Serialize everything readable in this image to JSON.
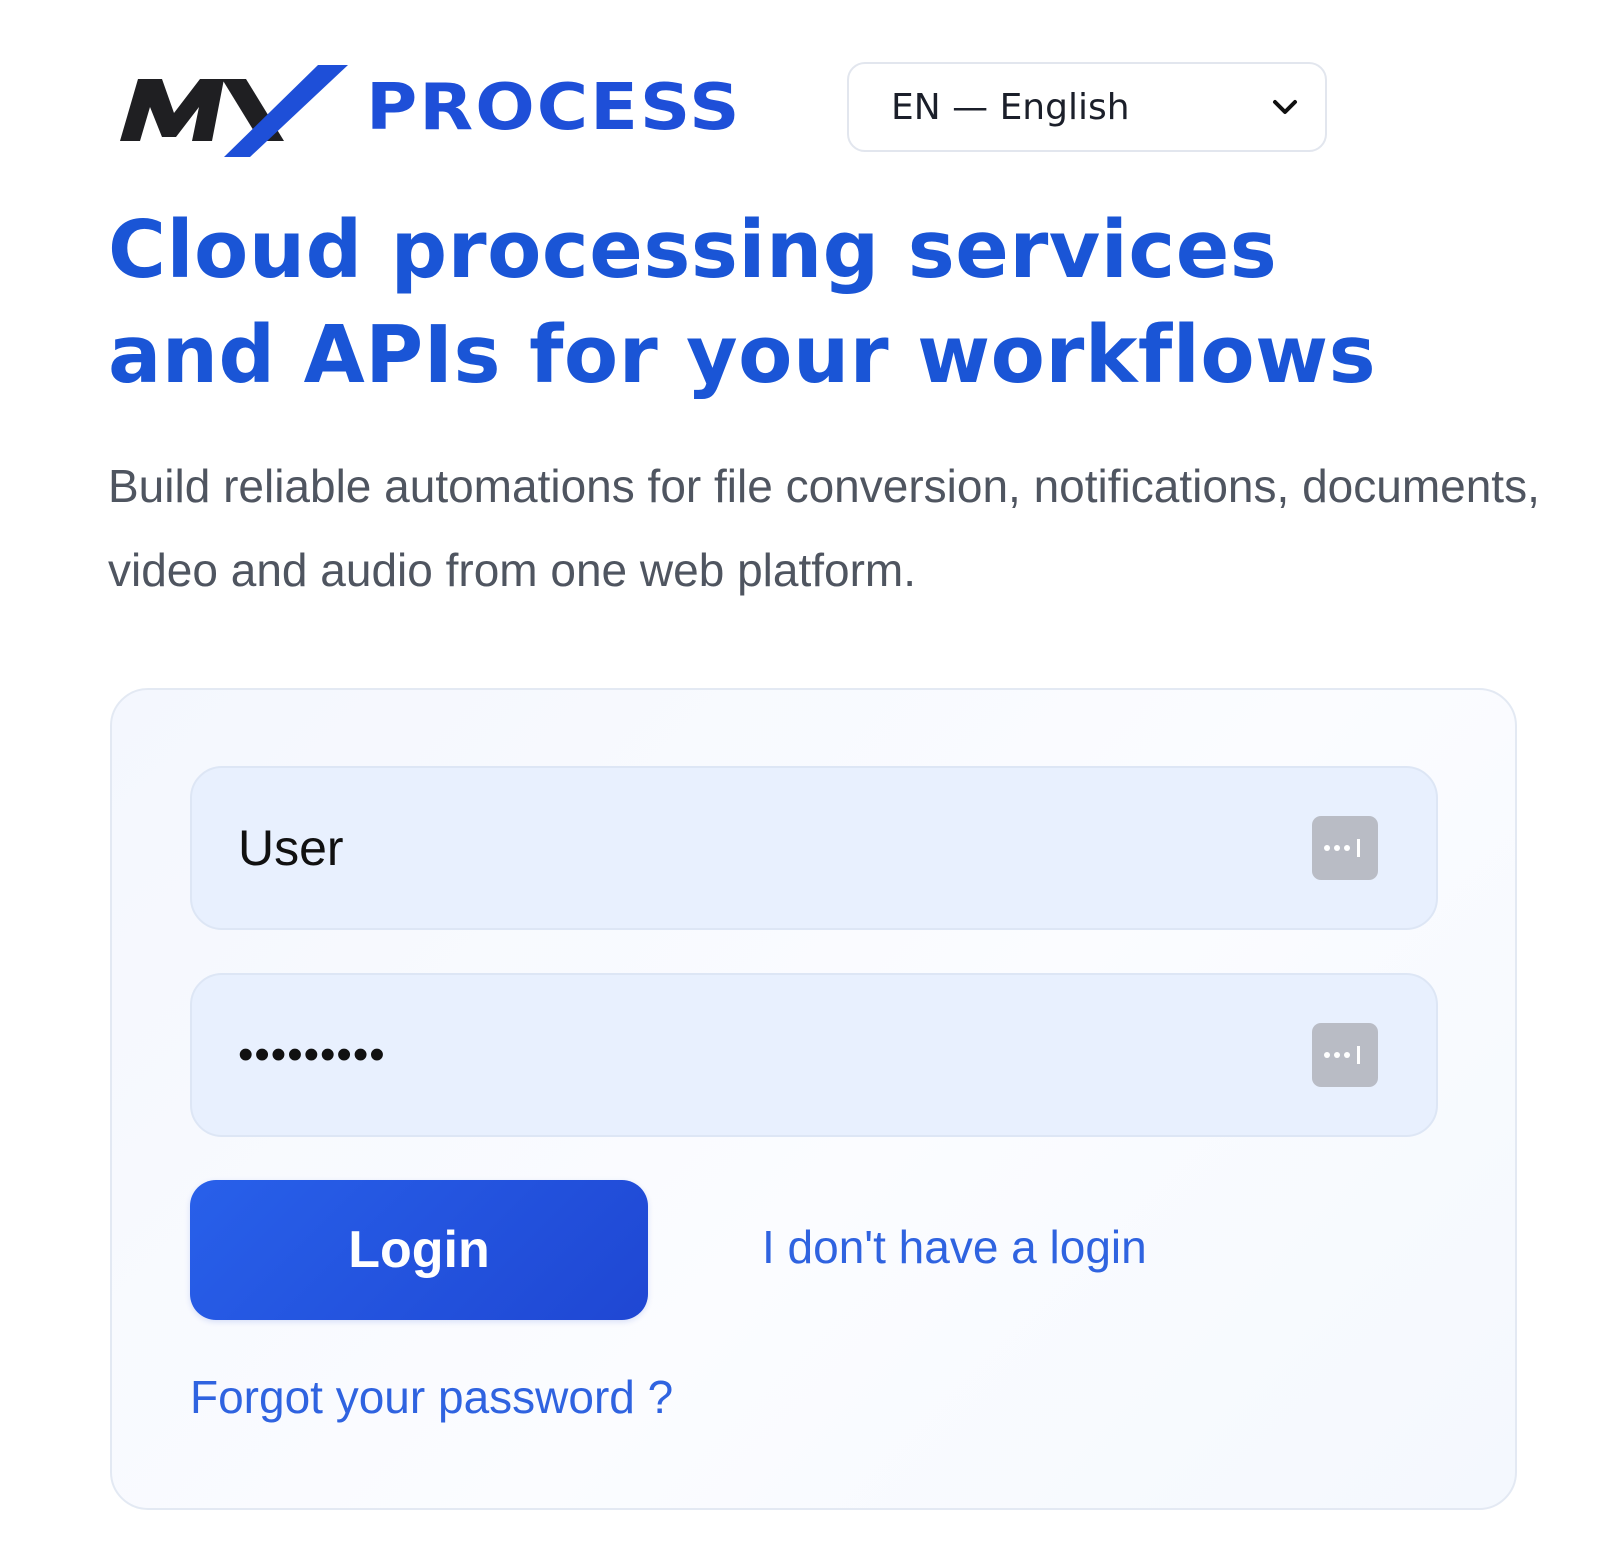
{
  "brand": {
    "logo_mark": "MX",
    "logo_word": "PROCESS",
    "colors": {
      "mark_dark": "#1f1f22",
      "mark_blue": "#1e4fd8",
      "word": "#1e4fd8"
    }
  },
  "language_select": {
    "selected": "EN — English",
    "icon": "chevron-down-icon"
  },
  "hero": {
    "title": "Cloud processing services and APIs for your workflows",
    "subtitle": "Build reliable automations for file conversion, notifications, documents, video and audio from one web platform."
  },
  "login_form": {
    "username": {
      "value": "User",
      "icon": "password-manager-icon"
    },
    "password": {
      "value": "password1",
      "icon": "password-manager-icon"
    },
    "submit_label": "Login",
    "signup_link": "I don't have a login",
    "forgot_link": "Forgot your password ?"
  },
  "colors": {
    "accent": "#1a55d6",
    "link": "#2f63e0",
    "button": "#2557e0",
    "field_bg": "#e8f0fe",
    "card_border": "#e3e9f3",
    "body_text": "#4f5560"
  }
}
